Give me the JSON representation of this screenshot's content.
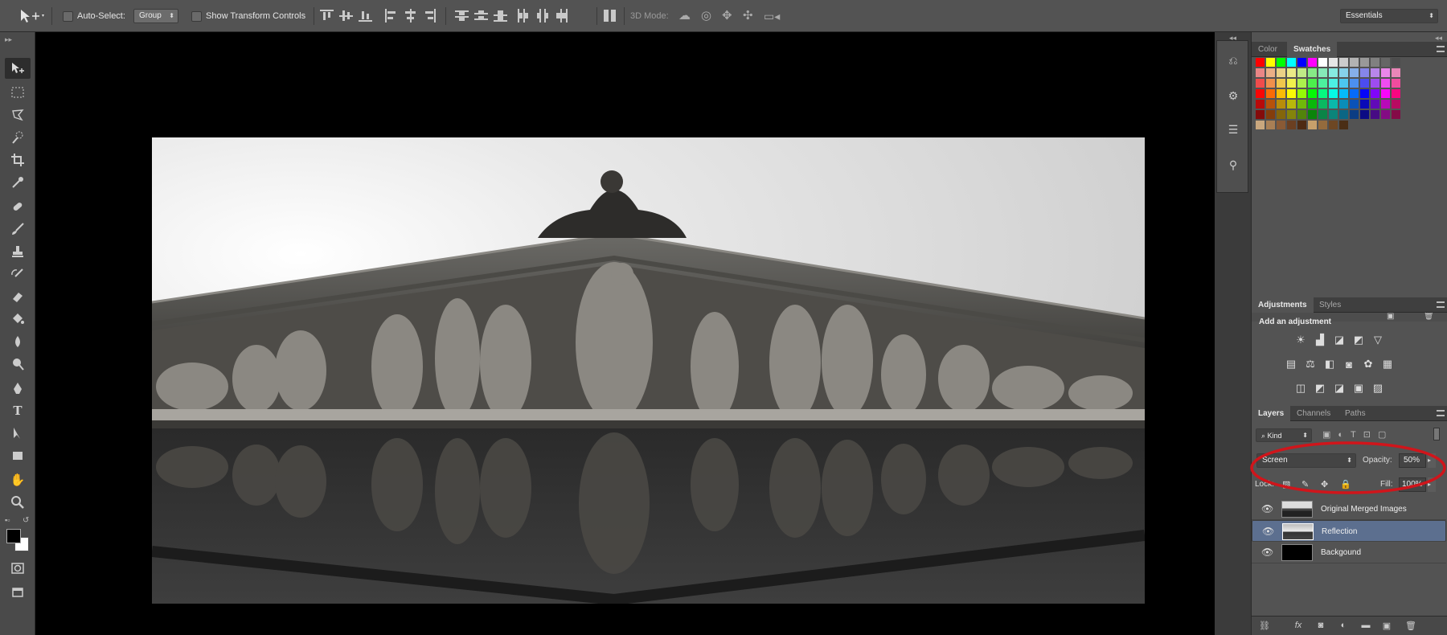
{
  "options_bar": {
    "auto_select_label": "Auto-Select:",
    "auto_select_value": "Group",
    "show_transform_label": "Show Transform Controls",
    "mode_label": "3D Mode:",
    "workspace": "Essentials"
  },
  "right_panel": {
    "color_tabs": [
      "Color",
      "Swatches"
    ],
    "adjust_tabs": [
      "Adjustments",
      "Styles"
    ],
    "adjust_heading": "Add an adjustment",
    "layer_tabs": [
      "Layers",
      "Channels",
      "Paths"
    ],
    "filter_kind": "Kind",
    "blend_mode": "Screen",
    "opacity_label": "Opacity:",
    "opacity_value": "50%",
    "lock_label": "Lock:",
    "fill_label": "Fill:",
    "fill_value": "100%",
    "layers": [
      {
        "name": "Original Merged Images",
        "selected": false
      },
      {
        "name": "Reflection",
        "selected": true
      },
      {
        "name": "Backgound",
        "selected": false
      }
    ]
  },
  "colors": {
    "highlight_ellipse": "#d0151b",
    "selected_layer": "#5c6f8f"
  }
}
